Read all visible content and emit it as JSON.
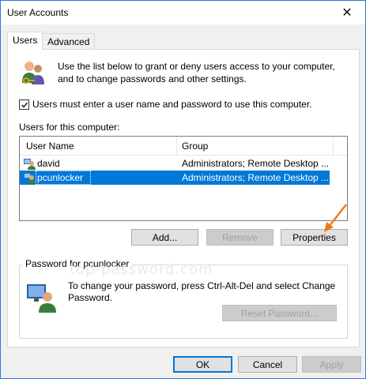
{
  "window": {
    "title": "User Accounts",
    "close_glyph": "✕"
  },
  "tabs": [
    {
      "label": "Users",
      "active": true
    },
    {
      "label": "Advanced",
      "active": false
    }
  ],
  "users_tab": {
    "intro": "Use the list below to grant or deny users access to your computer, and to change passwords and other settings.",
    "require_login": {
      "label": "Users must enter a user name and password to use this computer.",
      "checked": true
    },
    "list_label": "Users for this computer:",
    "columns": [
      "User Name",
      "Group"
    ],
    "rows": [
      {
        "name": "david",
        "group": "Administrators; Remote Desktop ...",
        "selected": false
      },
      {
        "name": "pcunlocker",
        "group": "Administrators; Remote Desktop ...",
        "selected": true
      }
    ],
    "buttons": {
      "add": "Add...",
      "remove": "Remove",
      "properties": "Properties"
    }
  },
  "password_group": {
    "title": "Password for pcunlocker",
    "text": "To change your password, press Ctrl-Alt-Del and select Change Password.",
    "reset_button": "Reset Password...",
    "watermark": "top-password.com"
  },
  "footer": {
    "ok": "OK",
    "cancel": "Cancel",
    "apply": "Apply"
  },
  "colors": {
    "accent": "#0078d7",
    "arrow": "#f07c1b"
  }
}
